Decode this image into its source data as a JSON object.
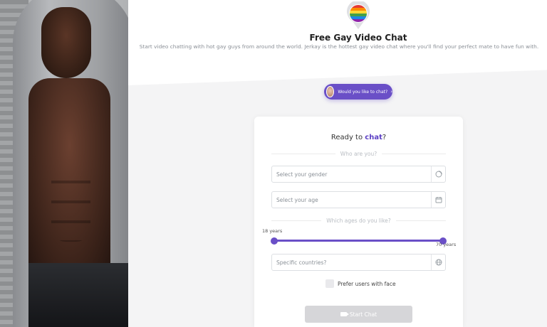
{
  "header": {
    "title": "Free Gay Video Chat",
    "subtitle": "Start video chatting with hot gay guys from around the world. Jerkay is the hottest gay video chat where you'll find your perfect mate to have fun with.",
    "logo_icon": "rainbow-pin-icon"
  },
  "promo": {
    "label": "Would you like to chat?",
    "chevron": "›"
  },
  "card": {
    "title_prefix": "Ready to ",
    "title_highlight": "chat",
    "title_suffix": "?",
    "who_divider": "Who are you?",
    "gender_placeholder": "Select your gender",
    "age_placeholder": "Select your age",
    "ages_divider": "Which ages do you like?",
    "age_min_label": "18 years",
    "age_max_label": "70 years",
    "age_range": {
      "min": 18,
      "max": 70
    },
    "countries_placeholder": "Specific countries?",
    "face_label": "Prefer users with face",
    "face_checked": false,
    "start_label": "Start Chat",
    "start_enabled": false
  },
  "colors": {
    "accent": "#6a4fc7",
    "button_disabled": "#d6d6d9"
  }
}
